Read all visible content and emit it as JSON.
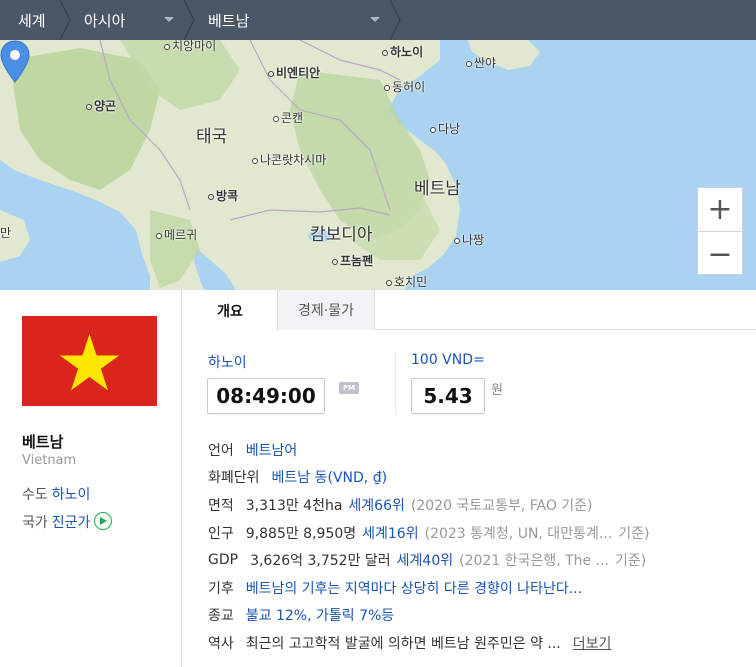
{
  "breadcrumb": {
    "items": [
      {
        "label": "세계",
        "has_dropdown": false
      },
      {
        "label": "아시아",
        "has_dropdown": true
      },
      {
        "label": "베트남",
        "has_dropdown": true
      }
    ]
  },
  "map": {
    "labels": {
      "chiangmai": "치앙마이",
      "vientiane": "비엔티안",
      "hanoi": "하노이",
      "shanya": "싼야",
      "yangon": "양곤",
      "donghoi": "동허이",
      "thailand": "태국",
      "khonkaen": "콘캔",
      "danang": "다낭",
      "nakhon": "나콘랏차시마",
      "vietnam": "베트남",
      "bangkok": "방콕",
      "cambodia": "캄보디아",
      "nhatrang": "나짱",
      "mergui": "메르귀",
      "phnompenh": "프놈펜",
      "hochiminh": "호치민",
      "left_edge": "만"
    },
    "zoom_in_icon": "plus-icon",
    "zoom_out_icon": "minus-icon",
    "marker_icon": "location-pin-icon",
    "colors": {
      "water": "#a9d3f0",
      "land": "#e3ead2",
      "forest": "#b9d49c",
      "pin": "#4a8ee6"
    }
  },
  "country": {
    "name": "베트남",
    "name_en": "Vietnam",
    "capital_label": "수도",
    "capital": "하노이",
    "anthem_label": "국가",
    "anthem": "진군가",
    "flag_colors": {
      "red": "#da251d",
      "star": "#ffe600"
    }
  },
  "tabs": [
    {
      "label": "개요",
      "active": true
    },
    {
      "label": "경제·물가",
      "active": false
    }
  ],
  "clock": {
    "city": "하노이",
    "time": "08:49:00",
    "ampm": "PM"
  },
  "exchange": {
    "base": "100 VND=",
    "rate": "5.43",
    "unit": "원"
  },
  "info": {
    "language": {
      "label": "언어",
      "value": "베트남어"
    },
    "currency": {
      "label": "화폐단위",
      "value": "베트남 동(VND, ₫)"
    },
    "area": {
      "label": "면적",
      "value": "3,313만 4천ha",
      "rank": "세계66위",
      "source": "(2020 국토교통부, FAO 기준)"
    },
    "population": {
      "label": "인구",
      "value": "9,885만 8,950명",
      "rank": "세계16위",
      "source": "(2023 통계청, UN, 대만통계...",
      "source_tail": "기준)"
    },
    "gdp": {
      "label": "GDP",
      "value": "3,626억 3,752만 달러",
      "rank": "세계40위",
      "source": "(2021 한국은행, The ...",
      "source_tail": "기준)"
    },
    "climate": {
      "label": "기후",
      "value": "베트남의 기후는 지역마다 상당히 다른 경향이 나타난다..."
    },
    "religion": {
      "label": "종교",
      "value": "불교 12%, 가톨릭 7%등"
    },
    "history": {
      "label": "역사",
      "value": "최근의 고고학적 발굴에 의하면 베트남 원주민은 약 ...",
      "more": "더보기"
    }
  }
}
